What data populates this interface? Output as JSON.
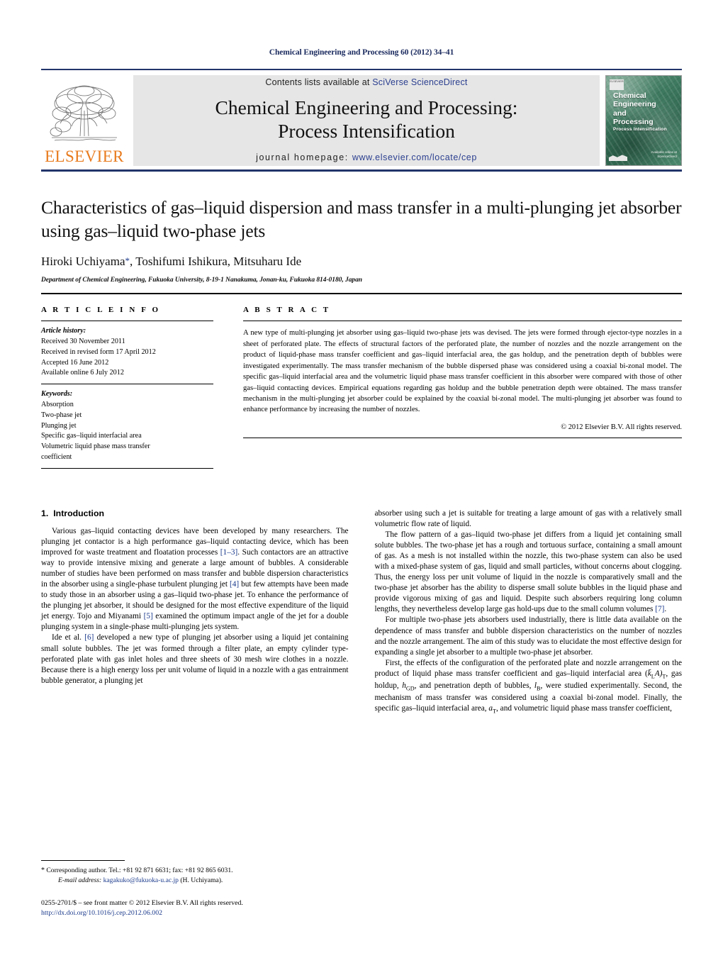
{
  "running_head": "Chemical Engineering and Processing 60 (2012) 34–41",
  "masthead": {
    "publisher_logo_text": "ELSEVIER",
    "contents_prefix": "Contents lists available at ",
    "contents_link": "SciVerse ScienceDirect",
    "journal_title_line1": "Chemical Engineering and Processing:",
    "journal_title_line2": "Process Intensification",
    "homepage_label": "journal homepage:",
    "homepage_url": "www.elsevier.com/locate/cep",
    "cover": {
      "badge": "ELSEVIER",
      "title_line1": "Chemical",
      "title_line2": "Engineering",
      "title_line3": "and",
      "title_line4": "Processing",
      "subtitle": "Process Intensification",
      "foot_line1": "Available online at",
      "foot_line2": "ScienceDirect"
    }
  },
  "article": {
    "title": "Characteristics of gas–liquid dispersion and mass transfer in a multi-plunging jet absorber using gas–liquid two-phase jets",
    "authors": "Hiroki Uchiyama",
    "author_star": "*",
    "authors_rest": ", Toshifumi Ishikura, Mitsuharu Ide",
    "affiliation": "Department of Chemical Engineering, Fukuoka University, 8-19-1 Nanakuma, Jonan-ku, Fukuoka 814-0180, Japan"
  },
  "info": {
    "heading": "A R T I C L E    I N F O",
    "history_label": "Article history:",
    "history": [
      "Received 30 November 2011",
      "Received in revised form 17 April 2012",
      "Accepted 16 June 2012",
      "Available online 6 July 2012"
    ],
    "keywords_label": "Keywords:",
    "keywords": [
      "Absorption",
      "Two-phase jet",
      "Plunging jet",
      "Specific gas–liquid interfacial area",
      "Volumetric liquid phase mass transfer",
      "coefficient"
    ]
  },
  "abstract": {
    "heading": "A B S T R A C T",
    "text": "A new type of multi-plunging jet absorber using gas–liquid two-phase jets was devised. The jets were formed through ejector-type nozzles in a sheet of perforated plate. The effects of structural factors of the perforated plate, the number of nozzles and the nozzle arrangement on the product of liquid-phase mass transfer coefficient and gas–liquid interfacial area, the gas holdup, and the penetration depth of bubbles were investigated experimentally. The mass transfer mechanism of the bubble dispersed phase was considered using a coaxial bi-zonal model. The specific gas–liquid interfacial area and the volumetric liquid phase mass transfer coefficient in this absorber were compared with those of other gas–liquid contacting devices. Empirical equations regarding gas holdup and the bubble penetration depth were obtained. The mass transfer mechanism in the multi-plunging jet absorber could be explained by the coaxial bi-zonal model. The multi-plunging jet absorber was found to enhance performance by increasing the number of nozzles.",
    "copyright": "© 2012 Elsevier B.V. All rights reserved."
  },
  "section": {
    "number": "1.",
    "title": "Introduction"
  },
  "left_column": {
    "p1_a": "Various gas–liquid contacting devices have been developed by many researchers. The plunging jet contactor is a high performance gas–liquid contacting device, which has been improved for waste treatment and floatation processes ",
    "p1_ref1": "[1–3]",
    "p1_b": ". Such contactors are an attractive way to provide intensive mixing and generate a large amount of bubbles. A considerable number of studies have been performed on mass transfer and bubble dispersion characteristics in the absorber using a single-phase turbulent plunging jet ",
    "p1_ref2": "[4]",
    "p1_c": " but few attempts have been made to study those in an absorber using a gas–liquid two-phase jet. To enhance the performance of the plunging jet absorber, it should be designed for the most effective expenditure of the liquid jet energy. Tojo and Miyanami ",
    "p1_ref3": "[5]",
    "p1_d": " examined the optimum impact angle of the jet for a double plunging system in a single-phase multi-plunging jets system.",
    "p2_a": "Ide et al. ",
    "p2_ref1": "[6]",
    "p2_b": " developed a new type of plunging jet absorber using a liquid jet containing small solute bubbles. The jet was formed through a filter plate, an empty cylinder type-perforated plate with gas inlet holes and three sheets of 30 mesh wire clothes in a nozzle. Because there is a high energy loss per unit volume of liquid in a nozzle with a gas entrainment bubble generator, a plunging jet"
  },
  "right_column": {
    "p0": "absorber using such a jet is suitable for treating a large amount of gas with a relatively small volumetric flow rate of liquid.",
    "p1": "The flow pattern of a gas–liquid two-phase jet differs from a liquid jet containing small solute bubbles. The two-phase jet has a rough and tortuous surface, containing a small amount of gas. As a mesh is not installed within the nozzle, this two-phase system can also be used with a mixed-phase system of gas, liquid and small particles, without concerns about clogging. Thus, the energy loss per unit volume of liquid in the nozzle is comparatively small and the two-phase jet absorber has the ability to disperse small solute bubbles in the liquid phase and provide vigorous mixing of gas and liquid. Despite such absorbers requiring long column lengths, they nevertheless develop large gas hold-ups due to the small column volumes ",
    "p1_ref": "[7]",
    "p1_end": ".",
    "p2": "For multiple two-phase jets absorbers used industrially, there is little data available on the dependence of mass transfer and bubble dispersion characteristics on the number of nozzles and the nozzle arrangement. The aim of this study was to elucidate the most effective design for expanding a single jet absorber to a multiple two-phase jet absorber.",
    "p3_a": "First, the effects of the configuration of the perforated plate and nozzle arrangement on the product of liquid phase mass transfer coefficient and gas–liquid interfacial area (",
    "p3_sym1": "k̄",
    "p3_sym1sub": "L",
    "p3_sym1b": "A)",
    "p3_sym1sub2": "T",
    "p3_b": ", gas holdup, ",
    "p3_sym2": "h",
    "p3_sym2sub": "GD",
    "p3_c": ", and penetration depth of bubbles, ",
    "p3_sym3": "l",
    "p3_sym3sub": "B",
    "p3_d": ", were studied experimentally. Second, the mechanism of mass transfer was considered using a coaxial bi-zonal model. Finally, the specific gas–liquid interfacial area, ",
    "p3_sym4": "a",
    "p3_sym4sub": "T",
    "p3_e": ", and volumetric liquid phase mass transfer coefficient,"
  },
  "footnotes": {
    "star": "*",
    "corresponding": " Corresponding author. Tel.: +81 92 871 6631; fax: +81 92 865 6031.",
    "email_label": "E-mail address:",
    "email": "kagakuko@fukuoka-u.ac.jp",
    "email_suffix": " (H. Uchiyama).",
    "issn_line": "0255-2701/$ – see front matter © 2012 Elsevier B.V. All rights reserved.",
    "doi": "http://dx.doi.org/10.1016/j.cep.2012.06.002"
  },
  "colors": {
    "link": "#1b3a8c",
    "rule": "#22356b",
    "elsevier_orange": "#e87b1e",
    "band_gray": "#e6e6e6"
  }
}
